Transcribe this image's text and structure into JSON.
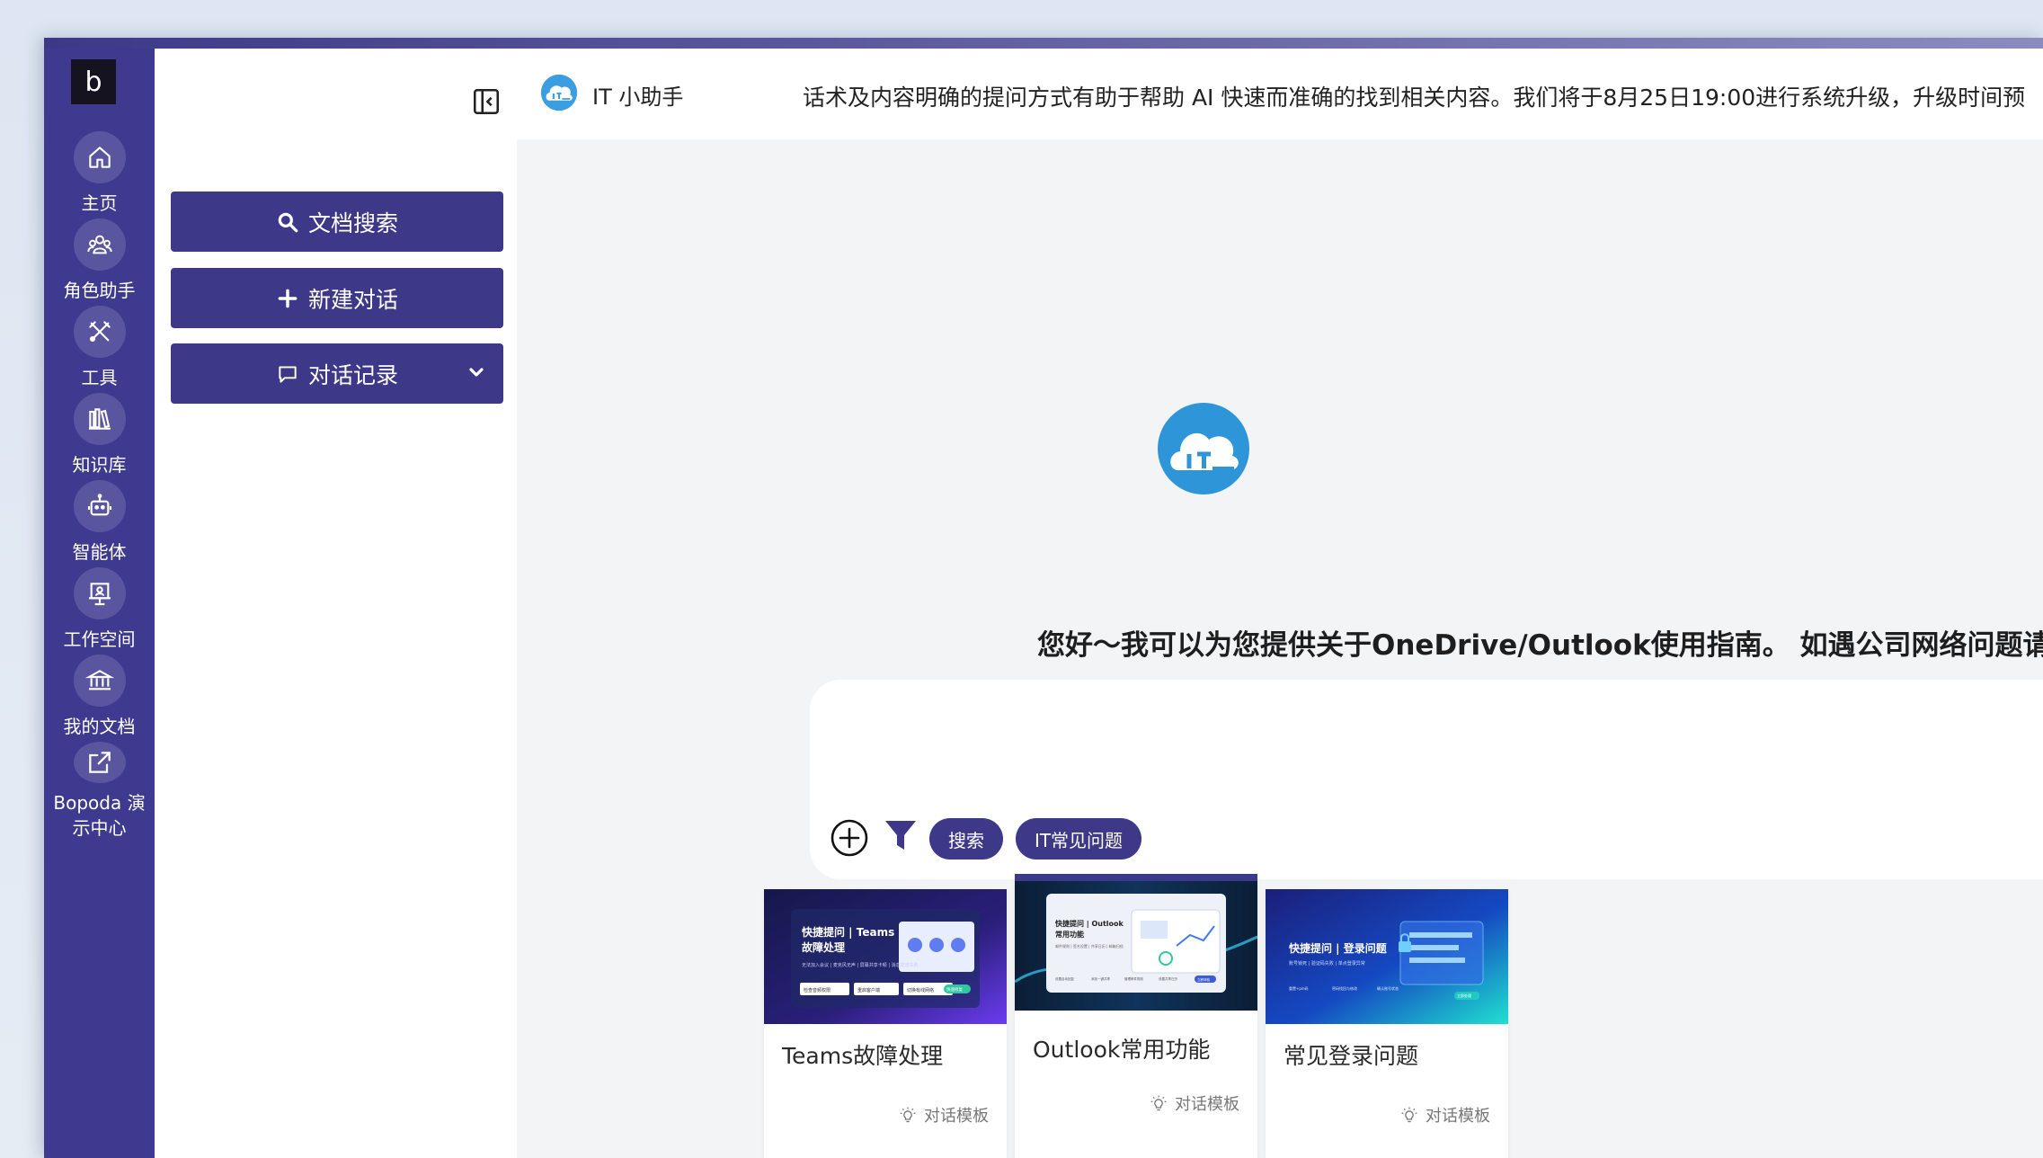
{
  "rail": {
    "logo": "b",
    "items": [
      {
        "label": "主页",
        "icon": "home-icon"
      },
      {
        "label": "角色助手",
        "icon": "people-icon"
      },
      {
        "label": "工具",
        "icon": "tools-icon"
      },
      {
        "label": "知识库",
        "icon": "library-icon"
      },
      {
        "label": "智能体",
        "icon": "robot-icon"
      },
      {
        "label": "工作空间",
        "icon": "workspace-icon"
      },
      {
        "label": "我的文档",
        "icon": "bank-icon"
      },
      {
        "label": "Bopoda 演示中心",
        "icon": "external-link-icon"
      }
    ]
  },
  "sidebar": {
    "search_label": "文档搜索",
    "new_chat_label": "新建对话",
    "history_label": "对话记录"
  },
  "header": {
    "app_name": "IT 小助手",
    "notice": "话术及内容明确的提问方式有助于帮助 AI 快速而准确的找到相关内容。我们将于8月25日19:00进行系统升级，升级时间预"
  },
  "main": {
    "greeting": "您好～我可以为您提供关于OneDrive/Outlook使用指南。 如遇公司网络问题请联系it(",
    "input_placeholder": "",
    "pills": [
      "搜索",
      "IT常见问题"
    ]
  },
  "cards": [
    {
      "title": "Teams故障处理",
      "tag": "对话模板",
      "banner_title": "快捷提问 | Teams",
      "banner_title2": "故障处理",
      "banner_sub": "无法加入会议 | 麦克风无声 | 屏幕共享卡顿 | 消息发送失败",
      "banner_chips": [
        "检查音频权限",
        "重启客户端",
        "切换有线网络"
      ],
      "banner_badge": "快速修复"
    },
    {
      "title": "Outlook常用功能",
      "tag": "对话模板",
      "banner_title": "快捷提问 | Outlook",
      "banner_title2": "常用功能",
      "banner_sub": "邮件规则 | 签名设置 | 共享日历 | 邮箱归档",
      "banner_chips": [
        "设置自动回复",
        "添加一键共享",
        "管理邮件规则",
        "设置共享日历"
      ],
      "banner_badge": "立即体验"
    },
    {
      "title": "常见登录问题",
      "tag": "对话模板",
      "banner_title": "快捷提问 | 登录问题",
      "banner_sub": "账号锁死 | 验证码失败 | 单点登录异常",
      "banner_chips": [
        "重置+pin码",
        "密码找回与修改",
        "确认账号状态"
      ],
      "banner_badge": "立即处理"
    }
  ]
}
